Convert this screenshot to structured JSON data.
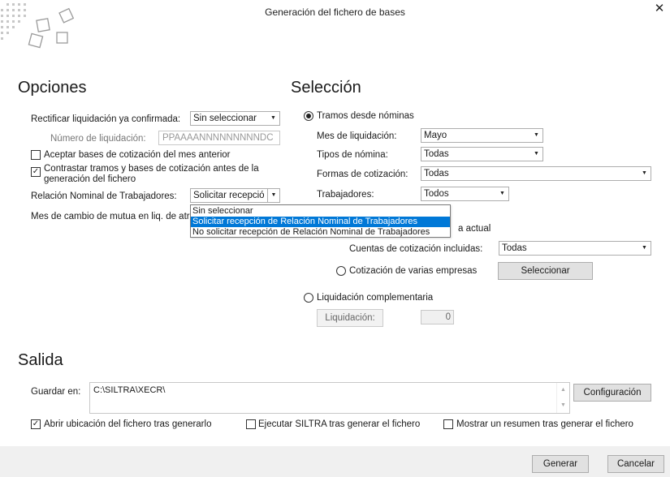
{
  "window": {
    "title": "Generación del fichero de bases",
    "close_glyph": "✕"
  },
  "opciones": {
    "heading": "Opciones",
    "rectificar_label": "Rectificar liquidación ya confirmada:",
    "rectificar_value": "Sin seleccionar",
    "numero_label": "Número de liquidación:",
    "numero_placeholder": "PPAAAANNNNNNNNNDC",
    "aceptar_label": "Aceptar bases de cotización del mes anterior",
    "aceptar_checked": false,
    "contrastar_label_1": "Contrastar tramos y bases de cotización antes de la",
    "contrastar_label_2": "generación del fichero",
    "contrastar_checked": true,
    "relacion_label": "Relación Nominal de Trabajadores:",
    "relacion_value": "Solicitar recepció",
    "relacion_options": [
      "Sin seleccionar",
      "Solicitar recepción de Relación Nominal de Trabajadores",
      "No solicitar recepción de Relación Nominal de Trabajadores"
    ],
    "relacion_selected_index": 1,
    "mes_cambio_label": "Mes de cambio de mutua en liq. de atr"
  },
  "seleccion": {
    "heading": "Selección",
    "tramos_label": "Tramos desde nóminas",
    "mes_label": "Mes de liquidación:",
    "mes_value": "Mayo",
    "tipos_label": "Tipos de nómina:",
    "tipos_value": "Todas",
    "formas_label": "Formas de cotización:",
    "formas_value": "Todas",
    "trabajadores_label": "Trabajadores:",
    "trabajadores_value": "Todos",
    "actual_fragment": "a actual",
    "cuentas_label": "Cuentas de cotización incluidas:",
    "cuentas_value": "Todas",
    "varias_label": "Cotización de varias empresas",
    "seleccionar_button": "Seleccionar",
    "complementaria_label": "Liquidación complementaria",
    "liquidacion_button": "Liquidación:",
    "liquidacion_value": "0"
  },
  "salida": {
    "heading": "Salida",
    "guardar_label": "Guardar en:",
    "guardar_value": "C:\\SILTRA\\XECR\\",
    "configuracion_button": "Configuración",
    "abrir_label": "Abrir ubicación del fichero tras generarlo",
    "abrir_checked": true,
    "ejecutar_label": "Ejecutar SILTRA tras generar el fichero",
    "ejecutar_checked": false,
    "resumen_label": "Mostrar un resumen tras generar el fichero",
    "resumen_checked": false
  },
  "footer": {
    "generar_button": "Generar",
    "cancelar_button": "Cancelar"
  },
  "icons": {
    "dropdown_arrow": "▼",
    "check": "✓",
    "scroll_up": "▲",
    "scroll_down": "▼"
  }
}
